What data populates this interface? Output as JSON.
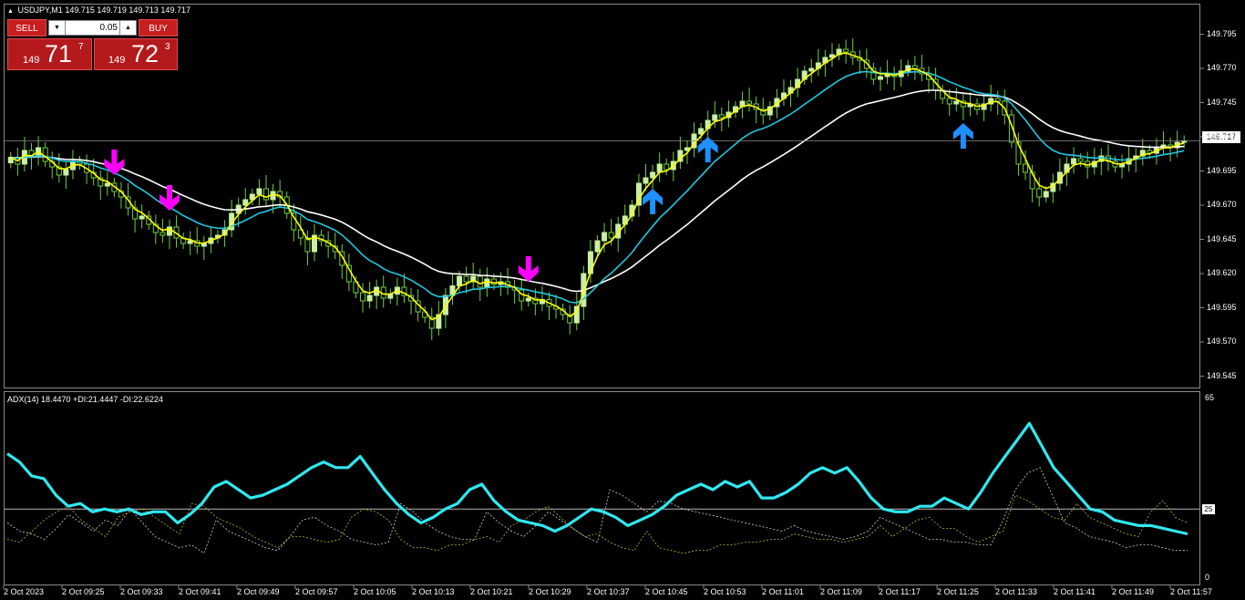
{
  "symbol_header": {
    "symbol": "USDJPY,M1",
    "ohlc": "149.715 149.719 149.713 149.717"
  },
  "trade_panel": {
    "sell_label": "SELL",
    "buy_label": "BUY",
    "lot_size": "0.05",
    "bid": {
      "prefix": "149",
      "big": "71",
      "pip": "7"
    },
    "ask": {
      "prefix": "149",
      "big": "72",
      "pip": "3"
    }
  },
  "indicator_header": "ADX(14) 18.4470 +DI:21.4447 -DI:22.6224",
  "current_price_label": "149.717",
  "adx_level_label": "25",
  "colors": {
    "background": "#000000",
    "bull_candle": "#c8f0a0",
    "wick": "#6fcf3c",
    "ema_fast": "#ffff00",
    "ema_mid": "#20c8e0",
    "ema_slow": "#ffffff",
    "sell_arrow": "#ff00ff",
    "buy_arrow": "#1e90ff",
    "adx_line": "#30e8f0",
    "di_plus": "#d0d0d0",
    "di_minus": "#b8b830"
  },
  "chart_data": [
    {
      "type": "candlestick",
      "price_axis": [
        "149.795",
        "149.770",
        "149.745",
        "149.720",
        "149.695",
        "149.670",
        "149.645",
        "149.620",
        "149.595",
        "149.570",
        "149.545"
      ],
      "ylim": [
        149.54,
        149.8
      ],
      "time_axis": [
        "2 Oct 2023",
        "2 Oct 09:25",
        "2 Oct 09:33",
        "2 Oct 09:41",
        "2 Oct 09:49",
        "2 Oct 09:57",
        "2 Oct 10:05",
        "2 Oct 10:13",
        "2 Oct 10:21",
        "2 Oct 10:29",
        "2 Oct 10:37",
        "2 Oct 10:45",
        "2 Oct 10:53",
        "2 Oct 11:01",
        "2 Oct 11:09",
        "2 Oct 11:17",
        "2 Oct 11:25",
        "2 Oct 11:33",
        "2 Oct 11:41",
        "2 Oct 11:49",
        "2 Oct 11:57"
      ],
      "current_price": 149.717,
      "close": [
        149.705,
        149.7,
        149.71,
        149.706,
        149.712,
        149.702,
        149.698,
        149.692,
        149.696,
        149.702,
        149.7,
        149.694,
        149.69,
        149.684,
        149.686,
        149.68,
        149.676,
        149.668,
        149.66,
        149.662,
        149.656,
        149.65,
        149.648,
        149.654,
        149.646,
        149.642,
        149.644,
        149.64,
        149.642,
        149.646,
        149.648,
        149.652,
        149.664,
        149.67,
        149.674,
        149.678,
        149.682,
        149.674,
        149.68,
        149.676,
        149.664,
        149.652,
        149.646,
        149.636,
        149.648,
        149.644,
        149.64,
        149.636,
        149.626,
        149.614,
        149.606,
        149.6,
        149.604,
        149.61,
        149.602,
        149.605,
        149.61,
        149.604,
        149.6,
        149.592,
        149.588,
        149.58,
        149.59,
        149.604,
        149.611,
        149.618,
        149.614,
        149.618,
        149.61,
        149.616,
        149.612,
        149.614,
        149.61,
        149.608,
        149.6,
        149.602,
        149.598,
        149.601,
        149.596,
        149.594,
        149.59,
        149.584,
        149.596,
        149.62,
        149.636,
        149.644,
        149.65,
        149.646,
        149.656,
        149.662,
        149.67,
        149.686,
        149.69,
        149.694,
        149.7,
        149.696,
        149.702,
        149.71,
        149.712,
        149.722,
        149.726,
        149.732,
        149.736,
        149.734,
        149.738,
        149.742,
        149.746,
        149.744,
        149.74,
        149.736,
        149.742,
        149.748,
        149.752,
        149.756,
        149.762,
        149.768,
        149.77,
        149.774,
        149.778,
        149.78,
        149.784,
        149.782,
        149.778,
        149.776,
        149.77,
        149.762,
        149.764,
        149.766,
        149.764,
        149.768,
        149.772,
        149.77,
        149.766,
        149.762,
        149.754,
        149.748,
        149.744,
        149.746,
        149.742,
        149.744,
        149.74,
        149.744,
        149.748,
        149.746,
        149.736,
        149.716,
        149.7,
        149.694,
        149.682,
        149.676,
        149.68,
        149.686,
        149.694,
        149.7,
        149.704,
        149.702,
        149.698,
        149.702,
        149.706,
        149.702,
        149.698,
        149.7,
        149.704,
        149.706,
        149.71,
        149.708,
        149.712,
        149.714,
        149.712,
        149.716,
        149.717
      ],
      "series": [
        {
          "name": "EMA fast",
          "color": "#ffff00"
        },
        {
          "name": "EMA mid",
          "color": "#20c8e0"
        },
        {
          "name": "EMA slow",
          "color": "#ffffff"
        }
      ],
      "signals": [
        {
          "time_index": 15,
          "type": "sell"
        },
        {
          "time_index": 23,
          "type": "sell"
        },
        {
          "time_index": 75,
          "type": "sell"
        },
        {
          "time_index": 93,
          "type": "buy"
        },
        {
          "time_index": 101,
          "type": "buy"
        },
        {
          "time_index": 138,
          "type": "buy"
        },
        {
          "time_index": 172,
          "type": "sell"
        }
      ]
    },
    {
      "type": "line",
      "title": "ADX(14) 18.4470 +DI:21.4447 -DI:22.6224",
      "ylim": [
        0,
        65
      ],
      "y_ticks": [
        "65",
        "25",
        "0"
      ],
      "level": 25,
      "series": [
        {
          "name": "ADX",
          "values": [
            45,
            42,
            37,
            36,
            30,
            26,
            27,
            24,
            25,
            24,
            25,
            23,
            24,
            24,
            20,
            23,
            27,
            33,
            35,
            32,
            29,
            30,
            32,
            34,
            37,
            40,
            42,
            40,
            40,
            44,
            38,
            32,
            27,
            23,
            20,
            22,
            25,
            27,
            32,
            34,
            28,
            24,
            21,
            20,
            19,
            17,
            19,
            22,
            25,
            24,
            22,
            19,
            21,
            23,
            26,
            30,
            32,
            34,
            32,
            35,
            33,
            35,
            29,
            29,
            31,
            34,
            38,
            40,
            38,
            40,
            35,
            29,
            25,
            24,
            24,
            26,
            26,
            29,
            27,
            25,
            31,
            38,
            44,
            50,
            56,
            48,
            40,
            35,
            30,
            25,
            24,
            21,
            20,
            19,
            19,
            18,
            17,
            16
          ]
        },
        {
          "name": "+DI",
          "values": [
            20,
            17,
            16,
            14,
            18,
            23,
            20,
            17,
            21,
            19,
            25,
            20,
            15,
            13,
            11,
            12,
            9,
            21,
            17,
            15,
            13,
            11,
            10,
            15,
            21,
            22,
            19,
            17,
            14,
            13,
            12,
            13,
            27,
            24,
            20,
            17,
            15,
            14,
            14,
            24,
            20,
            17,
            15,
            19,
            24,
            21,
            18,
            15,
            13,
            32,
            30,
            27,
            24,
            28,
            27,
            25,
            24,
            23,
            22,
            21,
            20,
            19,
            18,
            17,
            19,
            17,
            16,
            15,
            14,
            15,
            17,
            22,
            20,
            18,
            16,
            14,
            14,
            13,
            13,
            12,
            12,
            21,
            32,
            38,
            40,
            30,
            20,
            18,
            15,
            14,
            13,
            11,
            12,
            12,
            11,
            10,
            10
          ]
        },
        {
          "name": "-DI",
          "values": [
            14,
            13,
            17,
            21,
            24,
            26,
            21,
            18,
            15,
            22,
            24,
            25,
            22,
            19,
            16,
            27,
            26,
            22,
            20,
            18,
            15,
            13,
            11,
            15,
            15,
            14,
            13,
            14,
            22,
            25,
            24,
            21,
            14,
            11,
            11,
            10,
            12,
            12,
            14,
            15,
            13,
            19,
            21,
            24,
            26,
            22,
            18,
            15,
            16,
            13,
            11,
            10,
            17,
            11,
            10,
            9,
            10,
            10,
            12,
            12,
            13,
            13,
            14,
            14,
            16,
            15,
            14,
            14,
            13,
            14,
            15,
            19,
            15,
            18,
            21,
            22,
            18,
            18,
            15,
            13,
            15,
            17,
            30,
            28,
            25,
            22,
            21,
            27,
            22,
            20,
            18,
            16,
            15,
            24,
            28,
            22,
            20
          ]
        }
      ]
    }
  ]
}
